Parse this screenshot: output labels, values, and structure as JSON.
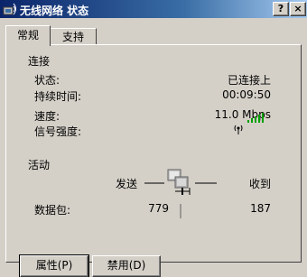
{
  "window": {
    "title": "无线网络 状态",
    "help_label": "?",
    "close_label": "×"
  },
  "tabs": [
    {
      "label": "常规",
      "active": true
    },
    {
      "label": "支持",
      "active": false
    }
  ],
  "connection": {
    "group_title": "连接",
    "status_label": "状态:",
    "status_value": "已连接上",
    "duration_label": "持续时间:",
    "duration_value": "00:09:50",
    "speed_label": "速度:",
    "speed_value": "11.0 Mbps",
    "signal_label": "信号强度:",
    "signal_bars": 5
  },
  "activity": {
    "group_title": "活动",
    "sent_label": "发送",
    "received_label": "收到",
    "packets_label": "数据包:",
    "packets_sent": "779",
    "packets_received": "187"
  },
  "buttons": {
    "properties_label": "属性(P)",
    "disable_label": "禁用(D)"
  },
  "colors": {
    "signal": "#00a000",
    "titlebar_start": "#0a246a",
    "titlebar_end": "#a6caf0"
  }
}
